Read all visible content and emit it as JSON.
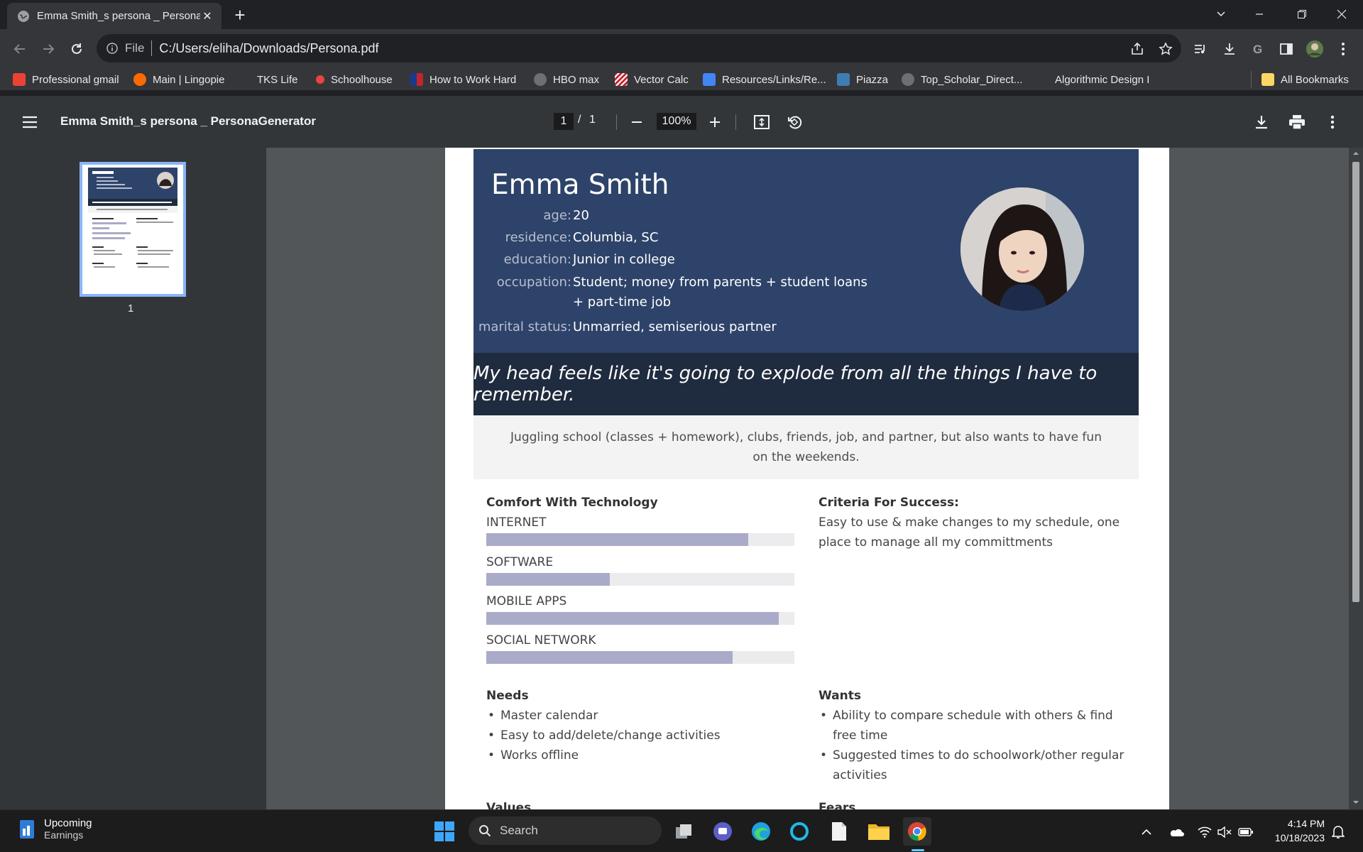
{
  "browser": {
    "tab_title": "Emma Smith_s persona _ PersonaGenerator",
    "omnibox_label": "File",
    "url": "C:/Users/eliha/Downloads/Persona.pdf"
  },
  "bookmarks": [
    {
      "label": "Professional gmail",
      "color": "#ea4335"
    },
    {
      "label": "Main | Lingopie",
      "color": "#ff6a00"
    },
    {
      "label": "TKS Life",
      "color": "#35363a"
    },
    {
      "label": "Schoolhouse",
      "color": "#e8453c"
    },
    {
      "label": "How to Work Hard",
      "color": "#1a3a8c"
    },
    {
      "label": "HBO max",
      "color": "#6c6f73"
    },
    {
      "label": "Vector Calc",
      "color": "#c0262d"
    },
    {
      "label": "Resources/Links/Re...",
      "color": "#4285f4"
    },
    {
      "label": "Piazza",
      "color": "#3e7cb1"
    },
    {
      "label": "Top_Scholar_Direct...",
      "color": "#6c6f73"
    },
    {
      "label": "Algorithmic Design I",
      "color": "#35363a"
    }
  ],
  "all_bookmarks": "All Bookmarks",
  "pdf_toolbar": {
    "title": "Emma Smith_s persona _ PersonaGenerator",
    "page_current": "1",
    "page_separator": "/",
    "page_total": "1",
    "zoom": "100%"
  },
  "sidebar": {
    "thumb_page_number": "1"
  },
  "persona": {
    "name": "Emma Smith",
    "facts": [
      {
        "label": "age:",
        "value": "20"
      },
      {
        "label": "residence:",
        "value": "Columbia, SC"
      },
      {
        "label": "education:",
        "value": "Junior in college"
      },
      {
        "label": "occupation:",
        "value": "Student; money from parents + student loans + part-time job"
      },
      {
        "label": "marital status:",
        "value": "Unmarried, semiserious partner"
      }
    ],
    "quote": "My head feels like it's going to explode from all the things I have to remember.",
    "summary": "Juggling school (classes + homework), clubs, friends, job, and partner, but also wants to have fun on the weekends.",
    "tech_title": "Comfort With Technology",
    "tech": [
      {
        "label": "INTERNET",
        "level": 0.85
      },
      {
        "label": "SOFTWARE",
        "level": 0.4
      },
      {
        "label": "MOBILE APPS",
        "level": 0.95
      },
      {
        "label": "SOCIAL NETWORK",
        "level": 0.8
      }
    ],
    "criteria_title": "Criteria For Success:",
    "criteria_text": "Easy to use & make changes to my schedule, one place to manage all my committments",
    "needs_title": "Needs",
    "needs": [
      "Master calendar",
      "Easy to add/delete/change activities",
      "Works offline"
    ],
    "wants_title": "Wants",
    "wants": [
      "Ability to compare schedule with others & find free time",
      "Suggested times to do schoolwork/other regular activities"
    ],
    "values_title": "Values",
    "fears_title": "Fears"
  },
  "taskbar": {
    "widget_title": "Upcoming",
    "widget_sub": "Earnings",
    "search_placeholder": "Search",
    "time": "4:14 PM",
    "date": "10/18/2023"
  }
}
